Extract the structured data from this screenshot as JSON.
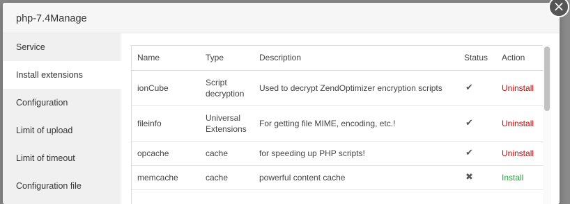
{
  "modal": {
    "title": "php-7.4Manage",
    "close_glyph": "×"
  },
  "sidebar": {
    "items": [
      {
        "label": "Service"
      },
      {
        "label": "Install extensions"
      },
      {
        "label": "Configuration"
      },
      {
        "label": "Limit of upload"
      },
      {
        "label": "Limit of timeout"
      },
      {
        "label": "Configuration file"
      }
    ],
    "active_index": 1
  },
  "table": {
    "headers": [
      "Name",
      "Type",
      "Description",
      "Status",
      "Action"
    ],
    "rows": [
      {
        "name": "ionCube",
        "type": "Script decryption",
        "description": "Used to decrypt ZendOptimizer encryption scripts",
        "status": "✔",
        "status_icon": "check-icon",
        "action": "Uninstall",
        "action_kind": "uninstall"
      },
      {
        "name": "fileinfo",
        "type": "Universal Extensions",
        "description": "For getting file MIME, encoding, etc.!",
        "status": "✔",
        "status_icon": "check-icon",
        "action": "Uninstall",
        "action_kind": "uninstall"
      },
      {
        "name": "opcache",
        "type": "cache",
        "description": "for speeding up PHP scripts!",
        "status": "✔",
        "status_icon": "check-icon",
        "action": "Uninstall",
        "action_kind": "uninstall"
      },
      {
        "name": "memcache",
        "type": "cache",
        "description": "powerful content cache",
        "status": "✖",
        "status_icon": "cross-icon",
        "action": "Install",
        "action_kind": "install"
      }
    ]
  },
  "colors": {
    "uninstall": "#d40000",
    "install": "#20a53a"
  }
}
